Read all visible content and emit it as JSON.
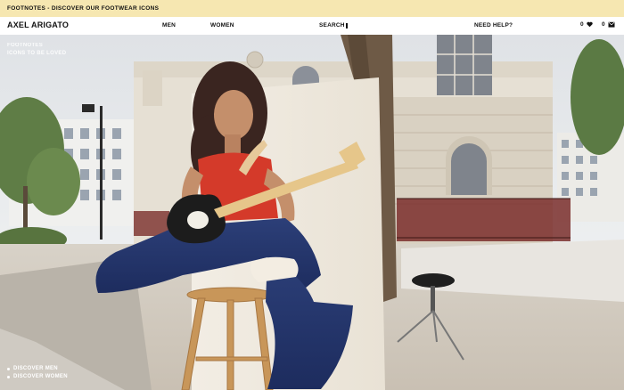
{
  "announcement": {
    "text": "FOOTNOTES - DISCOVER OUR FOOTWEAR ICONS"
  },
  "header": {
    "logo": "AXEL ARIGATO",
    "nav": {
      "men": "MEN",
      "women": "WOMEN"
    },
    "search_label": "SEARCH",
    "help_label": "NEED HELP?",
    "wishlist_count": "0",
    "bag_count": "0"
  },
  "hero": {
    "title_line1": "FOOTNOTES",
    "title_line2": "ICONS TO BE LOVED",
    "links": [
      "DISCOVER MEN",
      "DISCOVER WOMEN"
    ]
  },
  "colors": {
    "announcement_bg": "#f6e7b1",
    "accent": "#111111"
  },
  "icons": [
    "heart-icon",
    "bag-icon",
    "search-cursor-icon"
  ]
}
